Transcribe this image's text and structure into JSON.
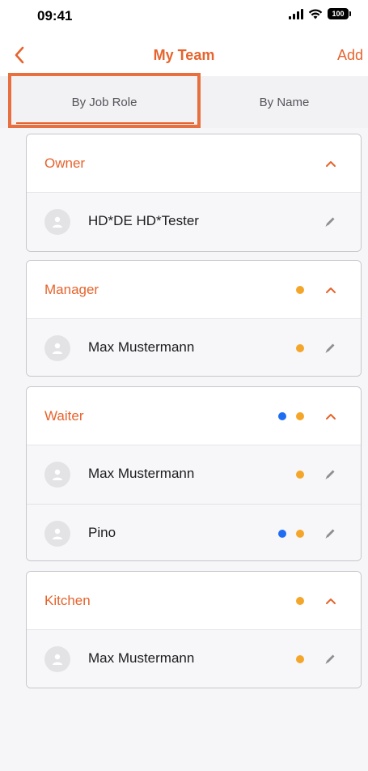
{
  "status_bar": {
    "time": "09:41",
    "battery": "100"
  },
  "nav": {
    "title": "My Team",
    "add_label": "Add"
  },
  "tabs": [
    {
      "label": "By Job Role"
    },
    {
      "label": "By Name"
    }
  ],
  "groups": [
    {
      "title": "Owner",
      "members": [
        {
          "name": "HD*DE HD*Tester"
        }
      ]
    },
    {
      "title": "Manager",
      "members": [
        {
          "name": "Max Mustermann"
        }
      ]
    },
    {
      "title": "Waiter",
      "members": [
        {
          "name": "Max Mustermann"
        },
        {
          "name": "Pino"
        }
      ]
    },
    {
      "title": "Kitchen",
      "members": [
        {
          "name": "Max Mustermann"
        }
      ]
    }
  ],
  "colors": {
    "accent": "#e6632d",
    "dot_orange": "#f4a62a",
    "dot_blue": "#1f6df3"
  }
}
